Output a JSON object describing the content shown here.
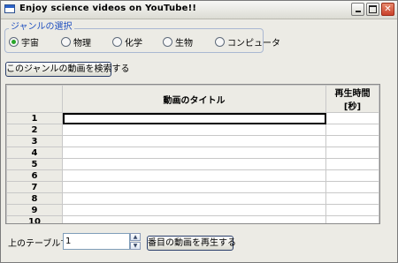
{
  "window": {
    "title": "Enjoy science videos on YouTube!!"
  },
  "genre_group": {
    "legend": "ジャンルの選択",
    "options": [
      {
        "label": "宇宙",
        "checked": true
      },
      {
        "label": "物理",
        "checked": false
      },
      {
        "label": "化学",
        "checked": false
      },
      {
        "label": "生物",
        "checked": false
      },
      {
        "label": "コンピュータ",
        "checked": false
      }
    ]
  },
  "search_button": "このジャンルの動画を検索する",
  "table": {
    "columns": [
      "動画のタイトル",
      "再生時間[秒]"
    ],
    "rows": [
      "1",
      "2",
      "3",
      "4",
      "5",
      "6",
      "7",
      "8",
      "9",
      "10"
    ]
  },
  "footer": {
    "label": "上のテーブルで",
    "spin_value": "1",
    "play_button": "番目の動画を再生する"
  }
}
